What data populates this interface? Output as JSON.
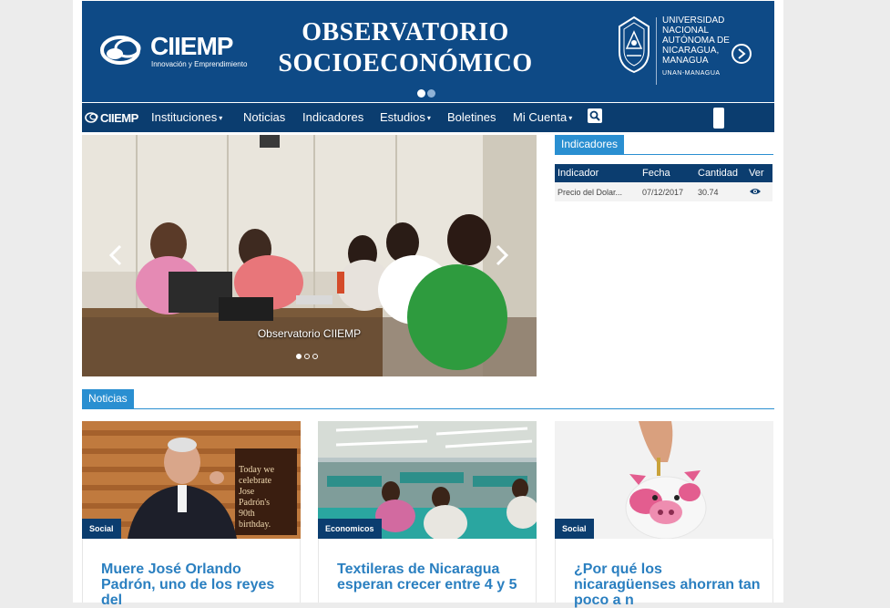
{
  "banner": {
    "logo_brand": "CIIEMP",
    "logo_tagline": "Innovación y Emprendimiento",
    "title_line1": "OBSERVATORIO",
    "title_line2": "SOCIOECONÓMICO",
    "university_lines": [
      "UNIVERSIDAD",
      "NACIONAL",
      "AUTÓNOMA DE",
      "NICARAGUA,",
      "MANAGUA"
    ],
    "university_short": "UNAN-MANAGUA",
    "slide_total": 2,
    "slide_active": 1
  },
  "nav": {
    "logo": "CIIEMP",
    "items": [
      {
        "label": "Instituciones",
        "dropdown": true
      },
      {
        "label": "Noticias",
        "dropdown": false
      },
      {
        "label": "Indicadores",
        "dropdown": false
      },
      {
        "label": "Estudios",
        "dropdown": true
      },
      {
        "label": "Boletines",
        "dropdown": false
      },
      {
        "label": "Mi Cuenta",
        "dropdown": true
      }
    ],
    "caret": "▾",
    "search_icon": "search-icon"
  },
  "carousel": {
    "caption": "Observatorio CIIEMP",
    "slide_total": 3,
    "slide_active": 1
  },
  "indicadores": {
    "tab_label": "Indicadores",
    "columns": [
      "Indicador",
      "Fecha",
      "Cantidad",
      "Ver"
    ],
    "rows": [
      {
        "indicador": "Precio del Dolar...",
        "fecha": "07/12/2017",
        "cantidad": "30.74",
        "ver": "eye-icon"
      }
    ]
  },
  "noticias": {
    "tab_label": "Noticias",
    "cards": [
      {
        "category": "Social",
        "title": "Muere José Orlando Padrón, uno de los reyes del",
        "image_text": [
          "Today we",
          "celebrate",
          "Jose",
          "Padrón's",
          "90th",
          "birthday."
        ]
      },
      {
        "category": "Economicos",
        "title": "Textileras de Nicaragua esperan crecer entre 4 y 5",
        "image_text": []
      },
      {
        "category": "Social",
        "title": "¿Por qué los nicaragüenses ahorran tan poco a n",
        "image_text": []
      }
    ]
  },
  "colors": {
    "banner_blue": "#0e4a86",
    "nav_navy": "#0b3d6f",
    "accent_blue": "#2a8fd1",
    "title_link": "#2a7fc0"
  }
}
